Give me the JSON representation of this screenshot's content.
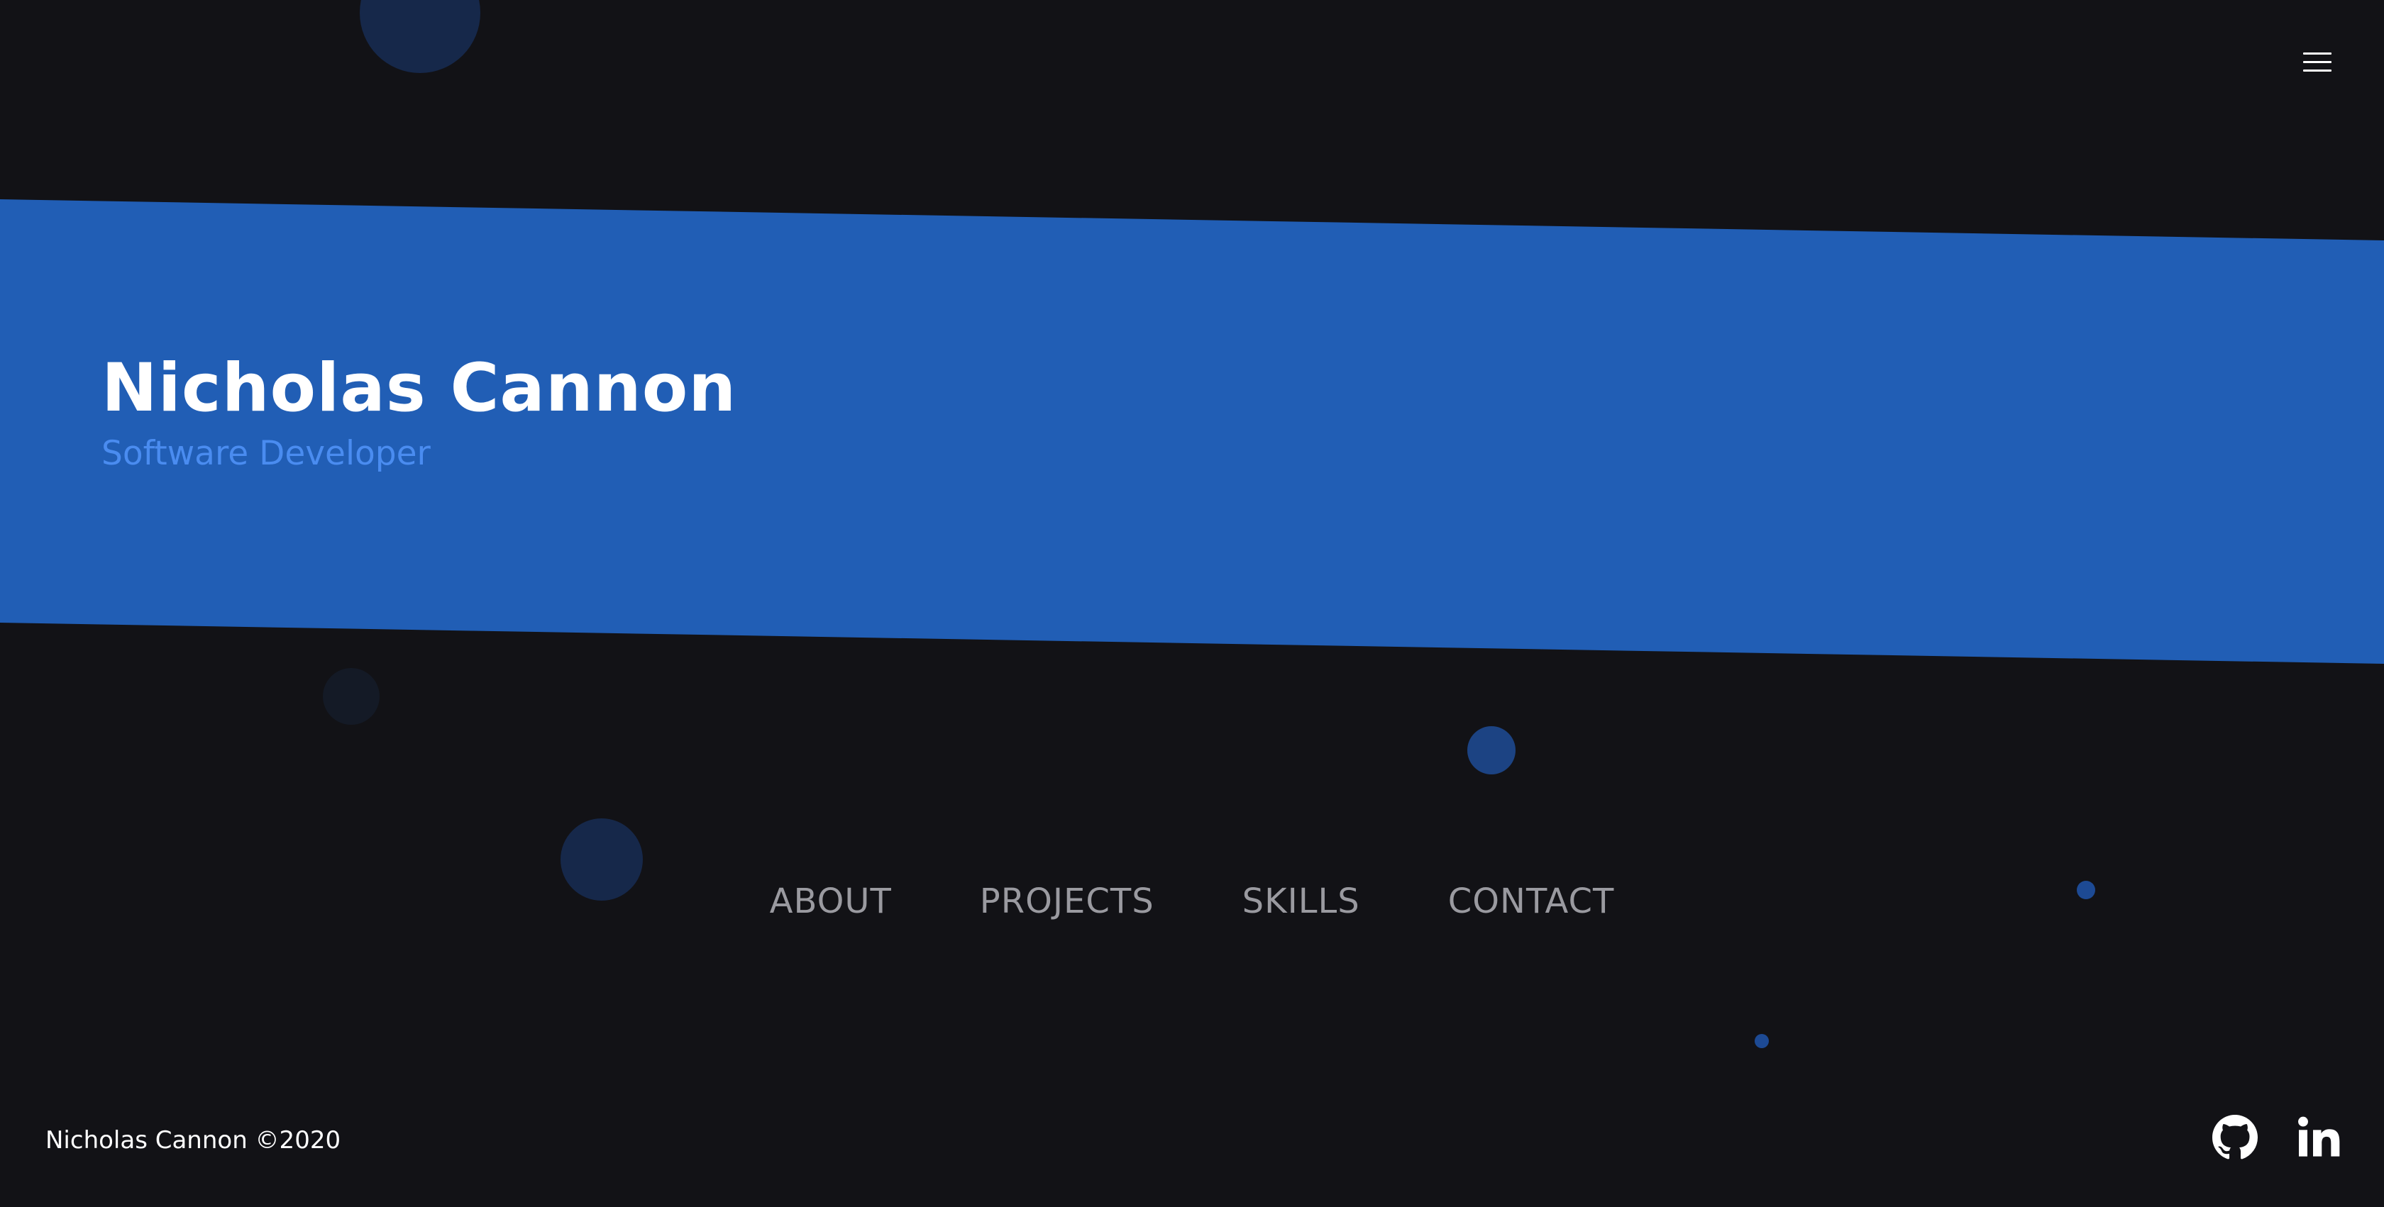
{
  "hero": {
    "name": "Nicholas Cannon",
    "role": "Software Developer"
  },
  "header": {
    "menu_icon": "hamburger-menu-icon"
  },
  "nav": {
    "items": [
      {
        "label": "ABOUT"
      },
      {
        "label": "PROJECTS"
      },
      {
        "label": "SKILLS"
      },
      {
        "label": "CONTACT"
      }
    ]
  },
  "footer": {
    "copyright": "Nicholas Cannon ©2020",
    "social": [
      {
        "icon": "github-icon"
      },
      {
        "icon": "linkedin-icon"
      }
    ]
  },
  "colors": {
    "background": "#121216",
    "band": "#215eb5",
    "accent": "#4a8cf0",
    "nav_text": "#9a9aa0",
    "bubble_dark": "#16284a",
    "bubble_mid": "#1d4a94"
  }
}
